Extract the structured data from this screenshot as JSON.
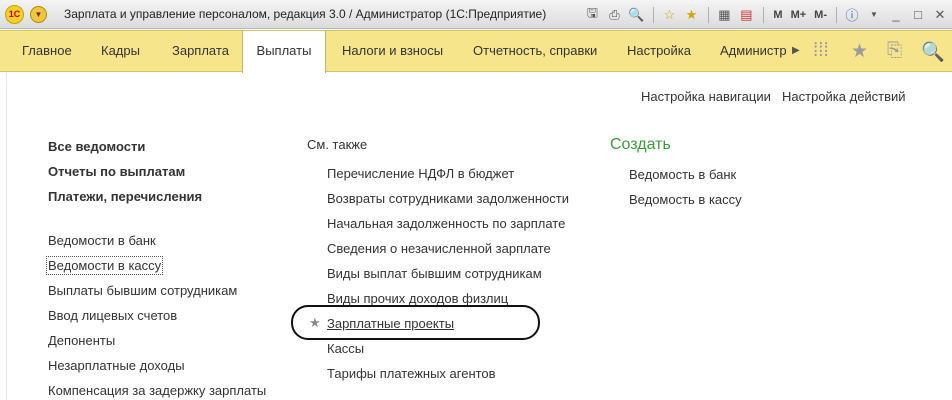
{
  "window": {
    "title": "Зарплата и управление персоналом, редакция 3.0 / Администратор  (1С:Предприятие)",
    "logo_text": "1С",
    "toolbar_text": {
      "m": "M",
      "mplus": "M+",
      "mminus": "M-"
    }
  },
  "tabs": [
    {
      "label": "Главное"
    },
    {
      "label": "Кадры"
    },
    {
      "label": "Зарплата"
    },
    {
      "label": "Выплаты"
    },
    {
      "label": "Налоги и взносы"
    },
    {
      "label": "Отчетность, справки"
    },
    {
      "label": "Настройка"
    },
    {
      "label": "Администр"
    }
  ],
  "active_tab": "Выплаты",
  "actions": {
    "nav_settings": "Настройка навигации",
    "action_settings": "Настройка действий"
  },
  "left": {
    "bold": [
      "Все ведомости",
      "Отчеты по выплатам",
      "Платежи, перечисления"
    ],
    "items": [
      "Ведомости в банк",
      "Ведомости в кассу",
      "Выплаты бывшим сотрудникам",
      "Ввод лицевых счетов",
      "Депоненты",
      "Незарплатные доходы",
      "Компенсация за задержку зарплаты"
    ]
  },
  "middle": {
    "header": "См. также",
    "items": [
      "Перечисление НДФЛ в бюджет",
      "Возвраты сотрудниками задолженности",
      "Начальная задолженность по зарплате",
      "Сведения о незачисленной зарплате",
      "Виды выплат бывшим сотрудникам",
      "Виды прочих доходов физлиц",
      "Зарплатные проекты",
      "Кассы",
      "Тарифы платежных агентов"
    ]
  },
  "right": {
    "header": "Создать",
    "items": [
      "Ведомость в банк",
      "Ведомость в кассу"
    ]
  }
}
